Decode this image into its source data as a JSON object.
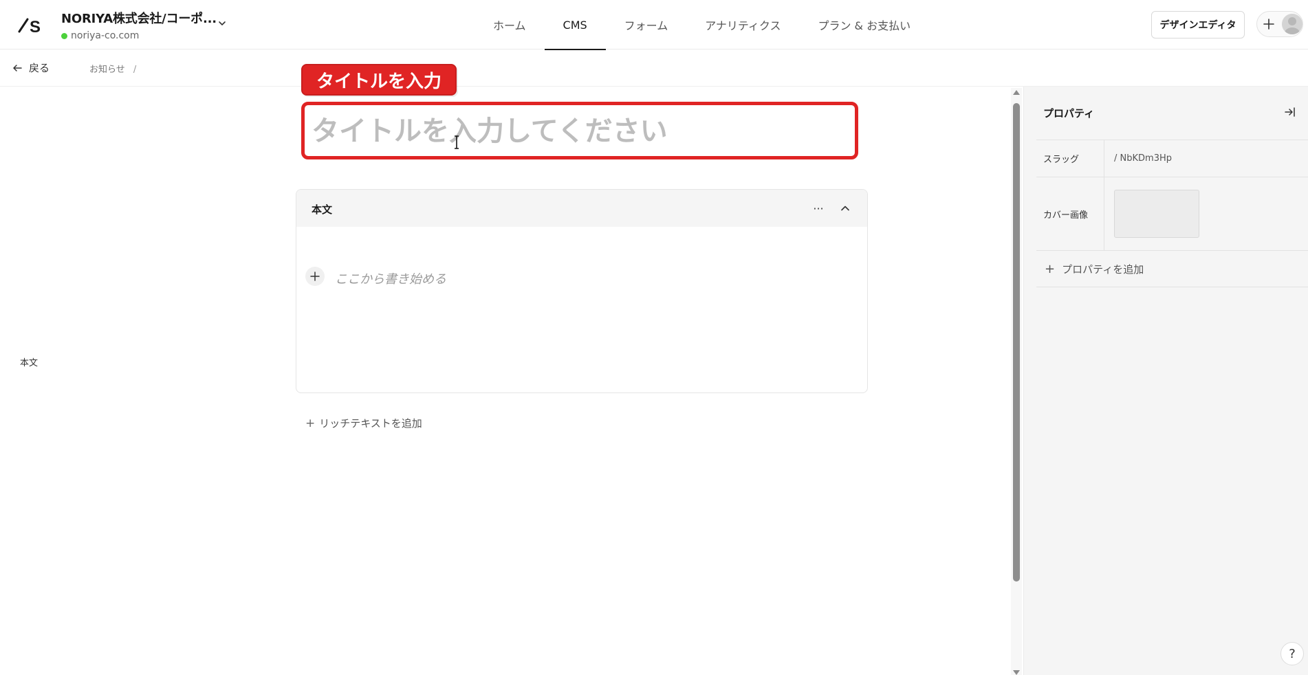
{
  "header": {
    "site_name": "NORIYA株式会社/コーポ...",
    "site_domain": "noriya-co.com",
    "nav": [
      {
        "label": "ホーム"
      },
      {
        "label": "CMS"
      },
      {
        "label": "フォーム"
      },
      {
        "label": "アナリティクス"
      },
      {
        "label": "プラン & お支払い"
      }
    ],
    "active_tab": "CMS",
    "design_editor_label": "デザインエディタ"
  },
  "subbar": {
    "back_label": "戻る",
    "breadcrumb": "お知らせ",
    "breadcrumb_sep": "/"
  },
  "editor": {
    "annotation_label": "タイトルを入力",
    "title_value": "",
    "title_placeholder": "タイトルを入力してください",
    "side_label": "本文",
    "body_section_title": "本文",
    "more_label": "···",
    "body_placeholder": "ここから書き始める",
    "add_rich_text_label": "リッチテキストを追加"
  },
  "properties": {
    "title": "プロパティ",
    "slug_label": "スラッグ",
    "slug_value": "/ NbKDm3Hp",
    "cover_label": "カバー画像",
    "add_property_label": "プロパティを追加"
  },
  "help_label": "?",
  "colors": {
    "accent_red": "#e02424",
    "status_green": "#4cd13b"
  }
}
